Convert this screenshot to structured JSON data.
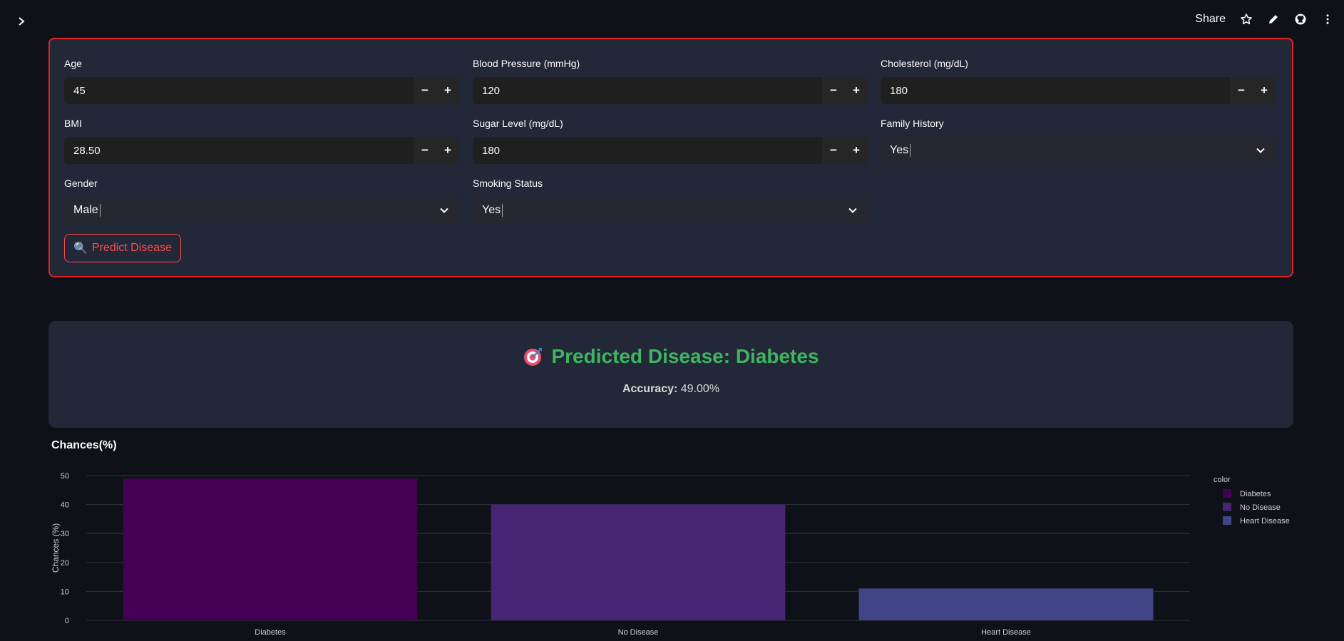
{
  "topbar": {
    "share_label": "Share",
    "icons": [
      "chevron-right-icon",
      "star-icon",
      "pencil-icon",
      "github-icon",
      "more-vertical-icon"
    ]
  },
  "form": {
    "age": {
      "label": "Age",
      "value": "45"
    },
    "blood_pressure": {
      "label": "Blood Pressure (mmHg)",
      "value": "120"
    },
    "cholesterol": {
      "label": "Cholesterol (mg/dL)",
      "value": "180"
    },
    "bmi": {
      "label": "BMI",
      "value": "28.50"
    },
    "sugar": {
      "label": "Sugar Level (mg/dL)",
      "value": "180"
    },
    "family_history": {
      "label": "Family History",
      "value": "Yes"
    },
    "gender": {
      "label": "Gender",
      "value": "Male"
    },
    "smoking": {
      "label": "Smoking Status",
      "value": "Yes"
    },
    "minus": "−",
    "plus": "+",
    "predict_label": "Predict Disease",
    "predict_icon": "🔍"
  },
  "result": {
    "title": "Predicted Disease: Diabetes",
    "accuracy_label": "Accuracy:",
    "accuracy_value": "49.00%"
  },
  "chart_title": "Chances(%)",
  "chart_data": {
    "type": "bar",
    "categories": [
      "Diabetes",
      "No Disease",
      "Heart Disease"
    ],
    "values": [
      49,
      40,
      11
    ],
    "colors": [
      "#440154",
      "#482475",
      "#414487"
    ],
    "ylabel": "Chances (%)",
    "xlabel": "",
    "ylim": [
      0,
      50
    ],
    "yticks": [
      0,
      10,
      20,
      30,
      40,
      50
    ],
    "grid": true,
    "legend": {
      "title": "color",
      "placement": "right"
    }
  }
}
